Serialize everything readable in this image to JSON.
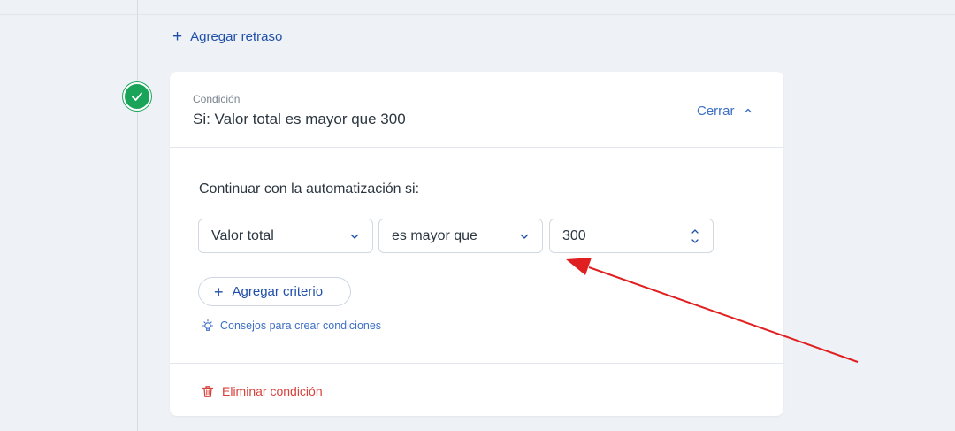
{
  "timeline": {
    "add_delay_label": "Agregar retraso"
  },
  "condition": {
    "label": "Condición",
    "summary": "Si: Valor total es mayor que 300",
    "close_label": "Cerrar",
    "continue_label": "Continuar con la automatización si:",
    "field_select": {
      "value": "Valor total"
    },
    "operator_select": {
      "value": "es mayor que"
    },
    "value_input": {
      "value": "300"
    },
    "add_criteria_label": "Agregar criterio",
    "tips_label": "Consejos para crear condiciones",
    "delete_label": "Eliminar condición"
  },
  "colors": {
    "accent": "#1f4fa8",
    "link": "#3d6fc4",
    "success": "#1aa45a",
    "danger": "#d8423d",
    "annotation_arrow": "#e02020"
  },
  "icons": {
    "step_badge": "check-icon",
    "add": "plus-icon",
    "collapse": "chevron-up-icon",
    "select": "chevron-down-icon",
    "stepper": "stepper-icon",
    "tips": "lightbulb-icon",
    "delete": "trash-icon"
  }
}
